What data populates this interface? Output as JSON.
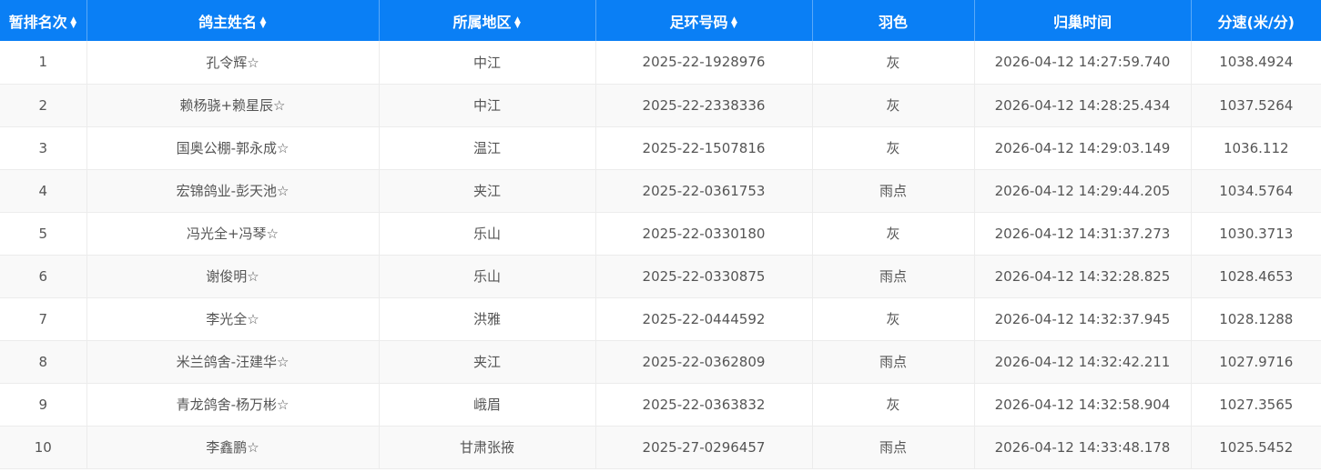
{
  "headers": [
    {
      "label": "暂排名次",
      "sortable": true
    },
    {
      "label": "鸽主姓名",
      "sortable": true
    },
    {
      "label": "所属地区",
      "sortable": true
    },
    {
      "label": "足环号码",
      "sortable": true
    },
    {
      "label": "羽色",
      "sortable": false
    },
    {
      "label": "归巢时间",
      "sortable": false
    },
    {
      "label": "分速(米/分)",
      "sortable": false
    }
  ],
  "rows": [
    {
      "rank": "1",
      "owner": "孔令辉☆",
      "region": "中江",
      "ring": "2025-22-1928976",
      "color": "灰",
      "time": "2026-04-12 14:27:59.740",
      "speed": "1038.4924"
    },
    {
      "rank": "2",
      "owner": "赖杨骁+赖星辰☆",
      "region": "中江",
      "ring": "2025-22-2338336",
      "color": "灰",
      "time": "2026-04-12 14:28:25.434",
      "speed": "1037.5264"
    },
    {
      "rank": "3",
      "owner": "国奥公棚-郭永成☆",
      "region": "温江",
      "ring": "2025-22-1507816",
      "color": "灰",
      "time": "2026-04-12 14:29:03.149",
      "speed": "1036.112"
    },
    {
      "rank": "4",
      "owner": "宏锦鸽业-彭天池☆",
      "region": "夹江",
      "ring": "2025-22-0361753",
      "color": "雨点",
      "time": "2026-04-12 14:29:44.205",
      "speed": "1034.5764"
    },
    {
      "rank": "5",
      "owner": "冯光全+冯琴☆",
      "region": "乐山",
      "ring": "2025-22-0330180",
      "color": "灰",
      "time": "2026-04-12 14:31:37.273",
      "speed": "1030.3713"
    },
    {
      "rank": "6",
      "owner": "谢俊明☆",
      "region": "乐山",
      "ring": "2025-22-0330875",
      "color": "雨点",
      "time": "2026-04-12 14:32:28.825",
      "speed": "1028.4653"
    },
    {
      "rank": "7",
      "owner": "李光全☆",
      "region": "洪雅",
      "ring": "2025-22-0444592",
      "color": "灰",
      "time": "2026-04-12 14:32:37.945",
      "speed": "1028.1288"
    },
    {
      "rank": "8",
      "owner": "米兰鸽舍-汪建华☆",
      "region": "夹江",
      "ring": "2025-22-0362809",
      "color": "雨点",
      "time": "2026-04-12 14:32:42.211",
      "speed": "1027.9716"
    },
    {
      "rank": "9",
      "owner": "青龙鸽舍-杨万彬☆",
      "region": "峨眉",
      "ring": "2025-22-0363832",
      "color": "灰",
      "time": "2026-04-12 14:32:58.904",
      "speed": "1027.3565"
    },
    {
      "rank": "10",
      "owner": "李鑫鹏☆",
      "region": "甘肃张掖",
      "ring": "2025-27-0296457",
      "color": "雨点",
      "time": "2026-04-12 14:33:48.178",
      "speed": "1025.5452"
    }
  ],
  "colors": {
    "header_bg": "#0a7ff5",
    "header_text": "#ffffff",
    "row_alt_bg": "#f9f9f9",
    "cell_text": "#555555"
  }
}
